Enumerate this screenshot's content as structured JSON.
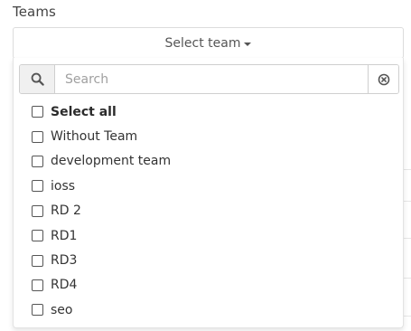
{
  "field_label": "Teams",
  "select_button": {
    "label": "Select team"
  },
  "search": {
    "placeholder": "Search",
    "value": ""
  },
  "options": [
    {
      "label": "Select all",
      "checked": false,
      "bold": true
    },
    {
      "label": "Without Team",
      "checked": false,
      "bold": false
    },
    {
      "label": "development team",
      "checked": false,
      "bold": false
    },
    {
      "label": "ioss",
      "checked": false,
      "bold": false
    },
    {
      "label": "RD 2",
      "checked": false,
      "bold": false
    },
    {
      "label": "RD1",
      "checked": false,
      "bold": false
    },
    {
      "label": "RD3",
      "checked": false,
      "bold": false
    },
    {
      "label": "RD4",
      "checked": false,
      "bold": false
    },
    {
      "label": "seo",
      "checked": false,
      "bold": false
    }
  ],
  "icons": {
    "search": "search-icon",
    "clear": "clear-circle-x-icon",
    "caret": "caret-down-icon"
  }
}
